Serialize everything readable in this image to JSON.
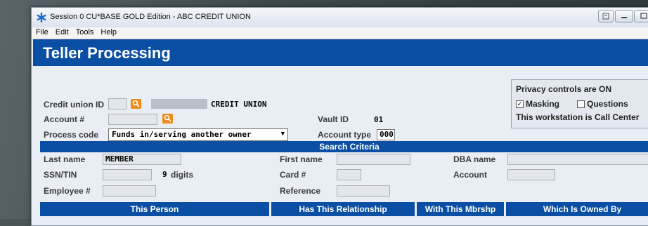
{
  "window": {
    "title": "Session 0 CU*BASE GOLD Edition - ABC CREDIT UNION"
  },
  "menu": {
    "items": [
      "File",
      "Edit",
      "Tools",
      "Help"
    ]
  },
  "header": {
    "title": "Teller Processing"
  },
  "form": {
    "credit_union_id_label": "Credit union ID",
    "credit_union_name": "CREDIT UNION",
    "account_label": "Account #",
    "process_code_label": "Process code",
    "process_code_value": "Funds in/serving another owner",
    "vault_id_label": "Vault ID",
    "vault_id_value": "01",
    "account_type_label": "Account type",
    "account_type_value": "000"
  },
  "privacy": {
    "heading": "Privacy controls are ON",
    "masking_label": "Masking",
    "masking_checked": true,
    "questions_label": "Questions",
    "questions_checked": false,
    "workstation_text": "This workstation is Call Center"
  },
  "search": {
    "title": "Search Criteria",
    "last_name_label": "Last name",
    "last_name_value": "MEMBER",
    "first_name_label": "First name",
    "dba_name_label": "DBA name",
    "ssn_label": "SSN/TIN",
    "ssn_digits_value": "9",
    "ssn_digits_suffix": "digits",
    "card_label": "Card #",
    "account_label": "Account",
    "employee_label": "Employee #",
    "reference_label": "Reference"
  },
  "results": {
    "columns": [
      "This Person",
      "Has This Relationship",
      "With This Mbrshp",
      "Which Is Owned By"
    ]
  },
  "colors": {
    "header_blue": "#0a4fa3",
    "lookup_orange": "#f08a1a"
  },
  "icons": {
    "app": "asterisk-icon",
    "lookup": "magnifier-icon"
  }
}
